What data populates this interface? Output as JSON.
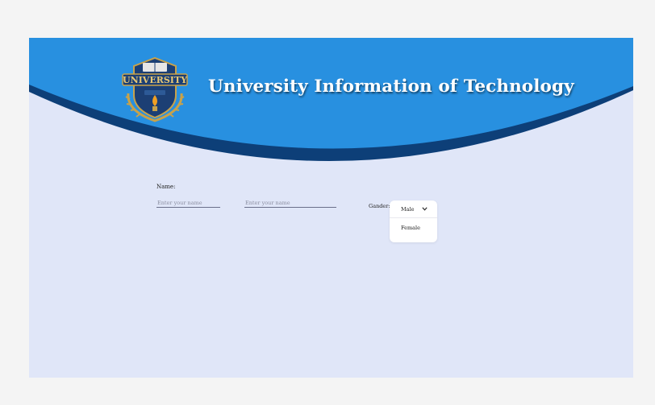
{
  "header": {
    "title": "University Information of Technology",
    "logo_text": "UNIVERSITY",
    "colors": {
      "banner": "#2890e0",
      "band": "#0d3f78",
      "page": "#e0e6f8"
    }
  },
  "form": {
    "name_label": "Name:",
    "first_name": {
      "placeholder": "Enter your name",
      "value": ""
    },
    "last_name": {
      "placeholder": "Enter your name",
      "value": ""
    },
    "gender_label": "Gander:",
    "gender_dropdown": {
      "selected": "Male",
      "options": [
        "Male",
        "Female"
      ],
      "icon": "chevron-down-icon"
    }
  }
}
